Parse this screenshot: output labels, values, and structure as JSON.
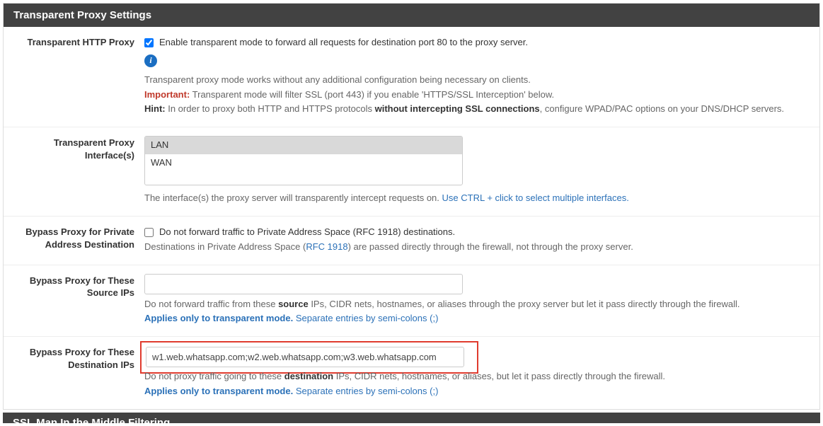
{
  "panel": {
    "title": "Transparent Proxy Settings"
  },
  "httpProxy": {
    "label": "Transparent HTTP Proxy",
    "checkboxLabel": "Enable transparent mode to forward all requests for destination port 80 to the proxy server.",
    "checked": true,
    "desc1": "Transparent proxy mode works without any additional configuration being necessary on clients.",
    "importantLabel": "Important:",
    "importantText": " Transparent mode will filter SSL (port 443) if you enable 'HTTPS/SSL Interception' below.",
    "hintLabel": "Hint:",
    "hintText1": " In order to proxy both HTTP and HTTPS protocols ",
    "hintBold": "without intercepting SSL connections",
    "hintText2": ", configure WPAD/PAC options on your DNS/DHCP servers."
  },
  "interfaces": {
    "label": "Transparent Proxy Interface(s)",
    "options": [
      "LAN",
      "WAN"
    ],
    "selected": "LAN",
    "desc1": "The interface(s) the proxy server will transparently intercept requests on. ",
    "desc2": "Use CTRL + click to select multiple interfaces."
  },
  "bypassPrivate": {
    "label": "Bypass Proxy for Private Address Destination",
    "checkboxLabel": "Do not forward traffic to Private Address Space (RFC 1918) destinations.",
    "checked": false,
    "desc1": "Destinations in Private Address Space (",
    "link": "RFC 1918",
    "desc2": ") are passed directly through the firewall, not through the proxy server."
  },
  "bypassSource": {
    "label": "Bypass Proxy for These Source IPs",
    "value": "",
    "desc1": "Do not forward traffic from these ",
    "bold1": "source",
    "desc2": " IPs, CIDR nets, hostnames, or aliases through the proxy server but let it pass directly through the firewall.",
    "applies": "Applies only to transparent mode.",
    "desc3": " Separate entries by semi-colons (;)"
  },
  "bypassDest": {
    "label": "Bypass Proxy for These Destination IPs",
    "value": "w1.web.whatsapp.com;w2.web.whatsapp.com;w3.web.whatsapp.com",
    "desc1": "Do not proxy traffic going to these ",
    "bold1": "destination",
    "desc2": " IPs, CIDR nets, hostnames, or aliases, but let it pass directly through the firewall.",
    "applies": "Applies only to transparent mode.",
    "desc3": " Separate entries by semi-colons (;)"
  },
  "nextPanel": {
    "title": "SSL Man In the Middle Filtering"
  }
}
